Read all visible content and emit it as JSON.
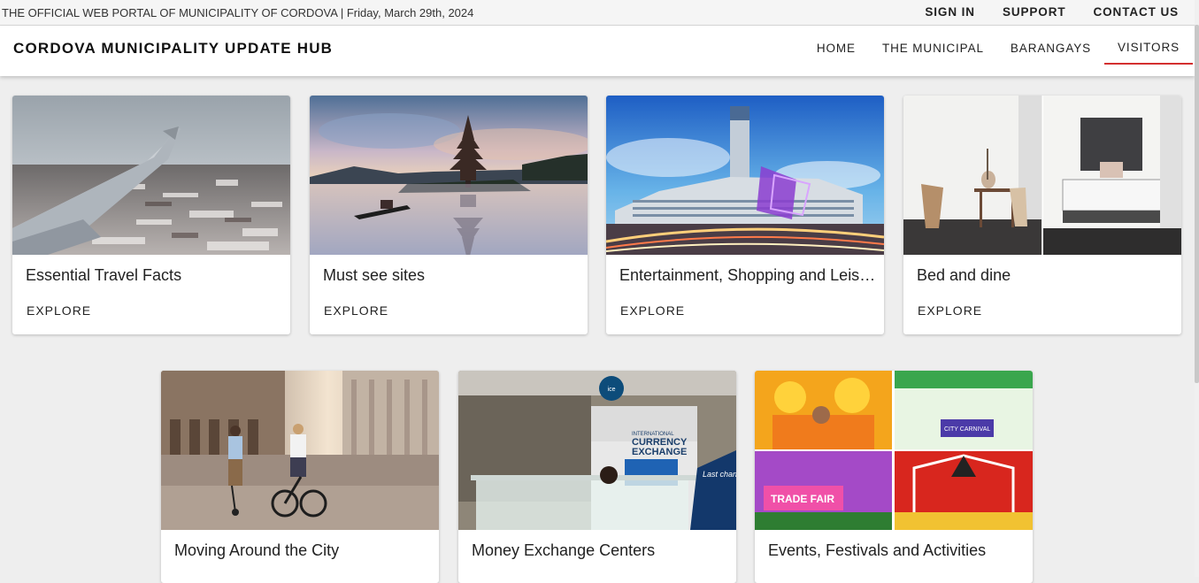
{
  "topbar": {
    "portal_text": "THE OFFICIAL WEB PORTAL OF MUNICIPALITY OF CORDOVA | Friday, March 29th, 2024",
    "links": [
      "SIGN IN",
      "SUPPORT",
      "CONTACT US"
    ]
  },
  "header": {
    "brand": "CORDOVA MUNICIPALITY UPDATE HUB",
    "nav": [
      "HOME",
      "THE MUNICIPAL",
      "BARANGAYS",
      "VISITORS"
    ],
    "active_nav": "VISITORS",
    "accent_color": "#d32f2f"
  },
  "cards": [
    {
      "title": "Essential Travel Facts",
      "action": "EXPLORE",
      "image": "airplane-wing-over-snowy-city"
    },
    {
      "title": "Must see sites",
      "action": "EXPLORE",
      "image": "temple-on-lake-at-sunrise"
    },
    {
      "title": "Entertainment, Shopping and Leisure",
      "action": "EXPLORE",
      "image": "mall-and-tower-at-dusk"
    },
    {
      "title": "Bed and dine",
      "action": "EXPLORE",
      "image": "dining-room-and-bedroom"
    },
    {
      "title": "Moving Around the City",
      "action": "",
      "image": "cyclists-in-plaza"
    },
    {
      "title": "Money Exchange Centers",
      "action": "",
      "image": "currency-exchange-booth"
    },
    {
      "title": "Events, Festivals and Activities",
      "action": "",
      "image": "festival-collage"
    }
  ],
  "images_text": {
    "currency_sign_1": "INTERNATIONAL",
    "currency_sign_2": "CURRENCY",
    "currency_sign_3": "EXCHANGE",
    "currency_logo": "ice",
    "currency_banner": "Last chance to buy currency!",
    "festival_banner_1": "TRADE FAIR",
    "festival_banner_2": "CITY CARNIVAL"
  }
}
